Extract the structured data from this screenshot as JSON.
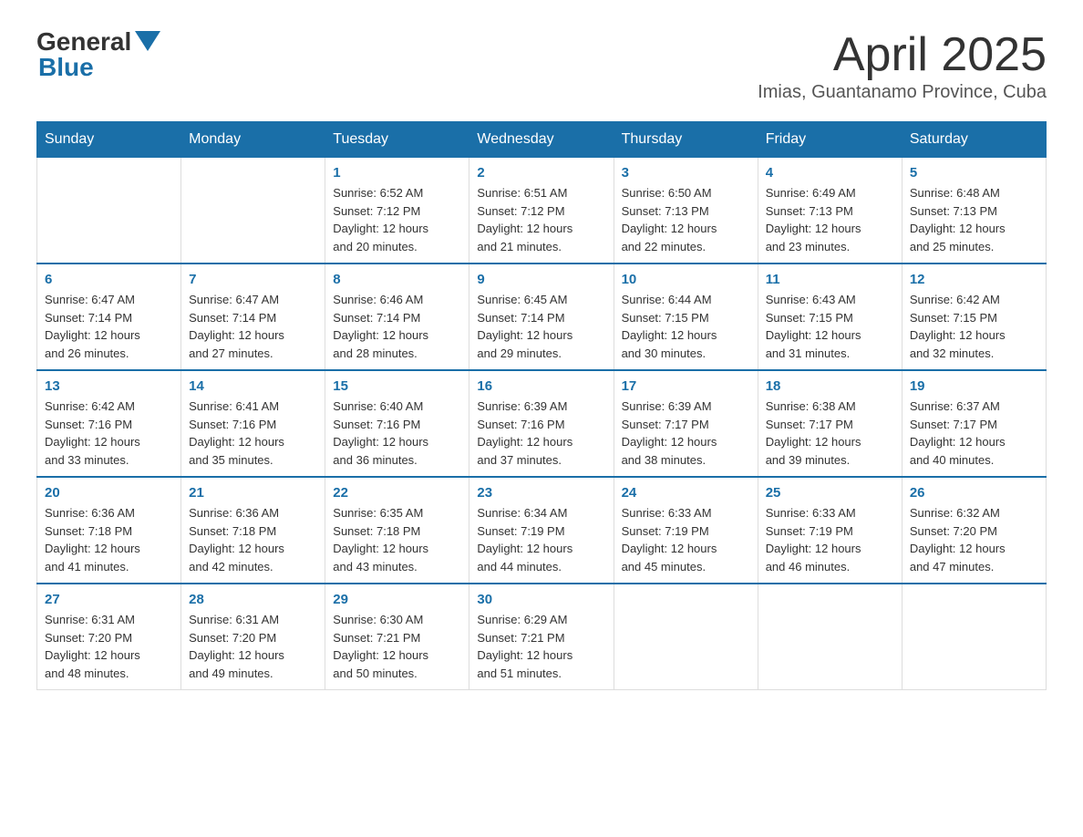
{
  "header": {
    "logo": {
      "general": "General",
      "blue": "Blue"
    },
    "title": "April 2025",
    "subtitle": "Imias, Guantanamo Province, Cuba"
  },
  "calendar": {
    "days_of_week": [
      "Sunday",
      "Monday",
      "Tuesday",
      "Wednesday",
      "Thursday",
      "Friday",
      "Saturday"
    ],
    "weeks": [
      [
        {
          "day": "",
          "info": ""
        },
        {
          "day": "",
          "info": ""
        },
        {
          "day": "1",
          "info": "Sunrise: 6:52 AM\nSunset: 7:12 PM\nDaylight: 12 hours\nand 20 minutes."
        },
        {
          "day": "2",
          "info": "Sunrise: 6:51 AM\nSunset: 7:12 PM\nDaylight: 12 hours\nand 21 minutes."
        },
        {
          "day": "3",
          "info": "Sunrise: 6:50 AM\nSunset: 7:13 PM\nDaylight: 12 hours\nand 22 minutes."
        },
        {
          "day": "4",
          "info": "Sunrise: 6:49 AM\nSunset: 7:13 PM\nDaylight: 12 hours\nand 23 minutes."
        },
        {
          "day": "5",
          "info": "Sunrise: 6:48 AM\nSunset: 7:13 PM\nDaylight: 12 hours\nand 25 minutes."
        }
      ],
      [
        {
          "day": "6",
          "info": "Sunrise: 6:47 AM\nSunset: 7:14 PM\nDaylight: 12 hours\nand 26 minutes."
        },
        {
          "day": "7",
          "info": "Sunrise: 6:47 AM\nSunset: 7:14 PM\nDaylight: 12 hours\nand 27 minutes."
        },
        {
          "day": "8",
          "info": "Sunrise: 6:46 AM\nSunset: 7:14 PM\nDaylight: 12 hours\nand 28 minutes."
        },
        {
          "day": "9",
          "info": "Sunrise: 6:45 AM\nSunset: 7:14 PM\nDaylight: 12 hours\nand 29 minutes."
        },
        {
          "day": "10",
          "info": "Sunrise: 6:44 AM\nSunset: 7:15 PM\nDaylight: 12 hours\nand 30 minutes."
        },
        {
          "day": "11",
          "info": "Sunrise: 6:43 AM\nSunset: 7:15 PM\nDaylight: 12 hours\nand 31 minutes."
        },
        {
          "day": "12",
          "info": "Sunrise: 6:42 AM\nSunset: 7:15 PM\nDaylight: 12 hours\nand 32 minutes."
        }
      ],
      [
        {
          "day": "13",
          "info": "Sunrise: 6:42 AM\nSunset: 7:16 PM\nDaylight: 12 hours\nand 33 minutes."
        },
        {
          "day": "14",
          "info": "Sunrise: 6:41 AM\nSunset: 7:16 PM\nDaylight: 12 hours\nand 35 minutes."
        },
        {
          "day": "15",
          "info": "Sunrise: 6:40 AM\nSunset: 7:16 PM\nDaylight: 12 hours\nand 36 minutes."
        },
        {
          "day": "16",
          "info": "Sunrise: 6:39 AM\nSunset: 7:16 PM\nDaylight: 12 hours\nand 37 minutes."
        },
        {
          "day": "17",
          "info": "Sunrise: 6:39 AM\nSunset: 7:17 PM\nDaylight: 12 hours\nand 38 minutes."
        },
        {
          "day": "18",
          "info": "Sunrise: 6:38 AM\nSunset: 7:17 PM\nDaylight: 12 hours\nand 39 minutes."
        },
        {
          "day": "19",
          "info": "Sunrise: 6:37 AM\nSunset: 7:17 PM\nDaylight: 12 hours\nand 40 minutes."
        }
      ],
      [
        {
          "day": "20",
          "info": "Sunrise: 6:36 AM\nSunset: 7:18 PM\nDaylight: 12 hours\nand 41 minutes."
        },
        {
          "day": "21",
          "info": "Sunrise: 6:36 AM\nSunset: 7:18 PM\nDaylight: 12 hours\nand 42 minutes."
        },
        {
          "day": "22",
          "info": "Sunrise: 6:35 AM\nSunset: 7:18 PM\nDaylight: 12 hours\nand 43 minutes."
        },
        {
          "day": "23",
          "info": "Sunrise: 6:34 AM\nSunset: 7:19 PM\nDaylight: 12 hours\nand 44 minutes."
        },
        {
          "day": "24",
          "info": "Sunrise: 6:33 AM\nSunset: 7:19 PM\nDaylight: 12 hours\nand 45 minutes."
        },
        {
          "day": "25",
          "info": "Sunrise: 6:33 AM\nSunset: 7:19 PM\nDaylight: 12 hours\nand 46 minutes."
        },
        {
          "day": "26",
          "info": "Sunrise: 6:32 AM\nSunset: 7:20 PM\nDaylight: 12 hours\nand 47 minutes."
        }
      ],
      [
        {
          "day": "27",
          "info": "Sunrise: 6:31 AM\nSunset: 7:20 PM\nDaylight: 12 hours\nand 48 minutes."
        },
        {
          "day": "28",
          "info": "Sunrise: 6:31 AM\nSunset: 7:20 PM\nDaylight: 12 hours\nand 49 minutes."
        },
        {
          "day": "29",
          "info": "Sunrise: 6:30 AM\nSunset: 7:21 PM\nDaylight: 12 hours\nand 50 minutes."
        },
        {
          "day": "30",
          "info": "Sunrise: 6:29 AM\nSunset: 7:21 PM\nDaylight: 12 hours\nand 51 minutes."
        },
        {
          "day": "",
          "info": ""
        },
        {
          "day": "",
          "info": ""
        },
        {
          "day": "",
          "info": ""
        }
      ]
    ]
  }
}
